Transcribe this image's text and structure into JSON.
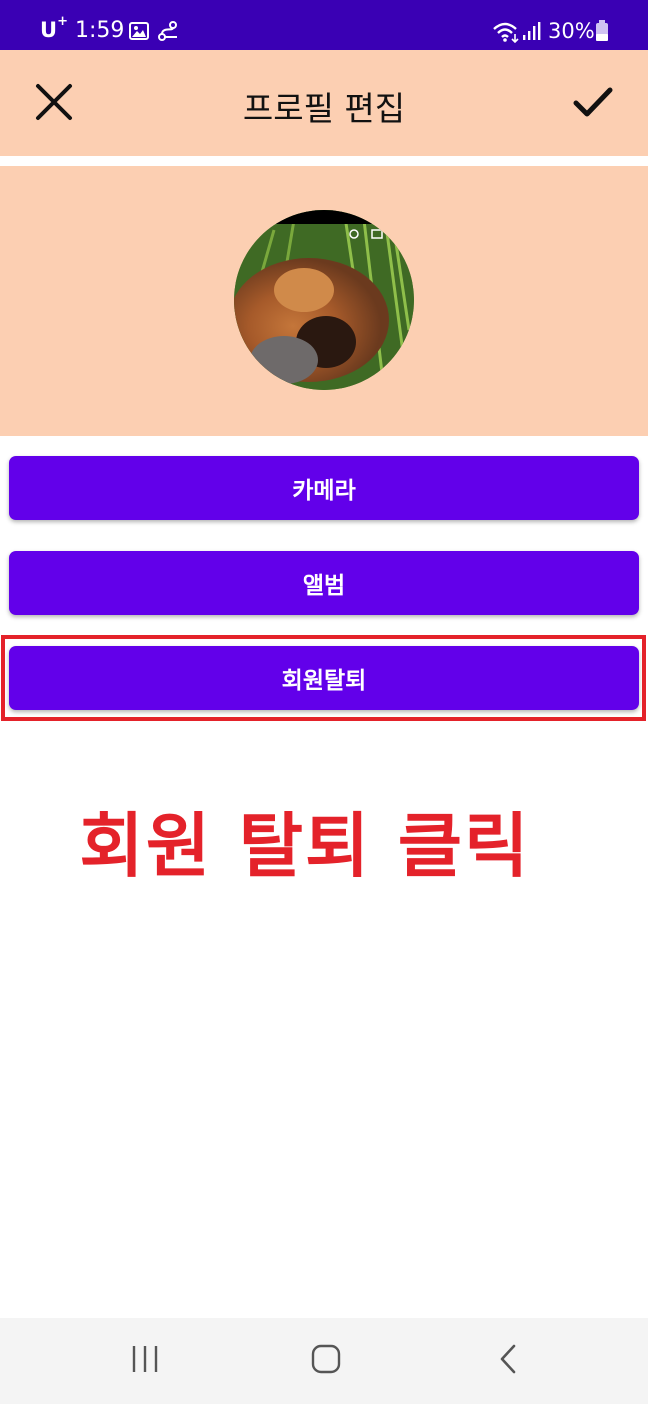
{
  "status_bar": {
    "carrier": "U",
    "carrier_sup": "+",
    "time": "1:59",
    "battery": "30%",
    "icons": [
      "image-icon",
      "link-icon",
      "wifi-icon",
      "signal-icon",
      "battery-icon"
    ]
  },
  "app_bar": {
    "title": "프로필 편집",
    "close_icon": "close-icon",
    "done_icon": "check-icon"
  },
  "profile": {
    "avatar_icon": "profile-photo"
  },
  "buttons": {
    "camera": "카메라",
    "album": "앨범",
    "withdraw": "회원탈퇴"
  },
  "annotation": "회원 탈퇴 클릭",
  "colors": {
    "status_bar": "#3a00b4",
    "header_bg": "#fccfb2",
    "button": "#6200ea",
    "highlight": "#e4222a"
  },
  "nav_bar": {
    "icons": [
      "recents-icon",
      "home-icon",
      "back-icon"
    ]
  }
}
